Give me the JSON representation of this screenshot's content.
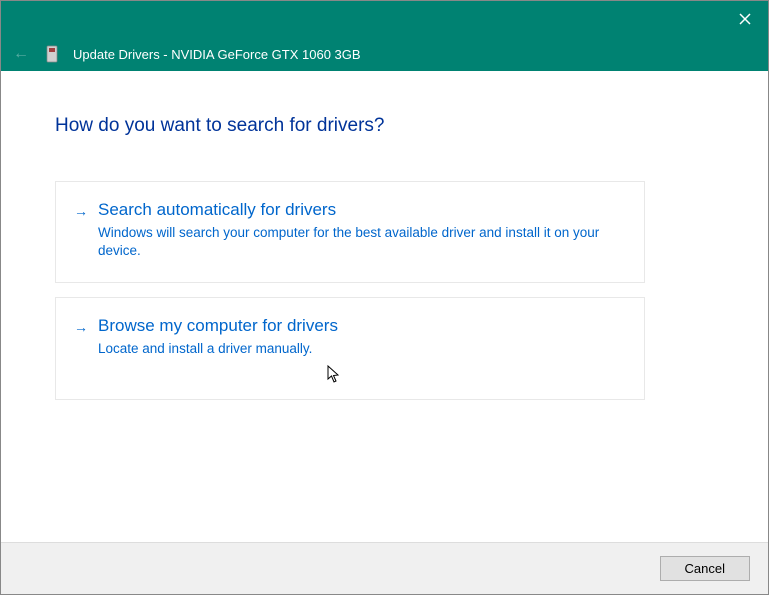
{
  "titlebar": {
    "text": "Update Drivers - NVIDIA GeForce GTX 1060 3GB"
  },
  "heading": "How do you want to search for drivers?",
  "options": [
    {
      "title": "Search automatically for drivers",
      "description": "Windows will search your computer for the best available driver and install it on your device."
    },
    {
      "title": "Browse my computer for drivers",
      "description": "Locate and install a driver manually."
    }
  ],
  "footer": {
    "cancel_label": "Cancel"
  }
}
